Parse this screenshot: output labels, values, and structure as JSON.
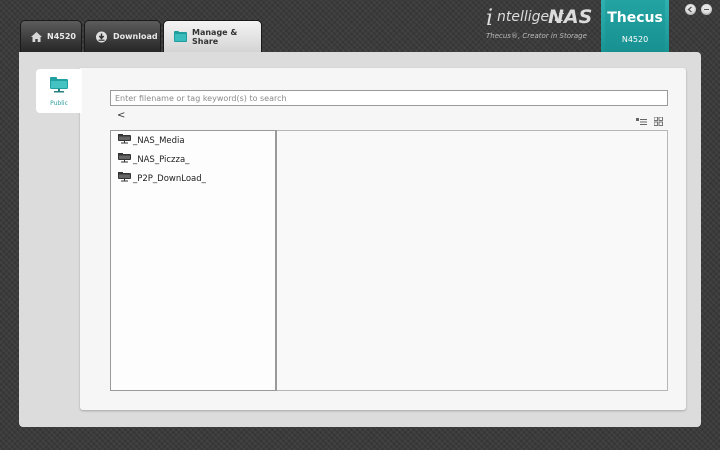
{
  "tabs": [
    {
      "label": "N4520",
      "icon": "home-icon"
    },
    {
      "label": "Download",
      "icon": "download-icon"
    },
    {
      "label": "Manage & Share",
      "icon": "folder-icon",
      "active": true
    }
  ],
  "brand": {
    "i": "i",
    "intelligent": "ntelligent",
    "nas": "NAS",
    "tagline": "Thecus®, Creator in Storage",
    "logo": "Thecus",
    "model": "N4520",
    "accent": "#1a9a9a"
  },
  "window_buttons": [
    "back-icon",
    "minimize-icon"
  ],
  "sidebar": {
    "label": "Public",
    "icon": "share-folder-icon"
  },
  "search": {
    "placeholder": "Enter filename or tag keyword(s) to search",
    "value": ""
  },
  "nav": {
    "back_label": "<"
  },
  "view_toggles": [
    "list-view-icon",
    "grid-view-icon"
  ],
  "tree": [
    {
      "label": "_NAS_Media",
      "icon": "share-folder-icon"
    },
    {
      "label": "_NAS_Piczza_",
      "icon": "share-folder-icon"
    },
    {
      "label": "_P2P_DownLoad_",
      "icon": "share-folder-icon"
    }
  ]
}
